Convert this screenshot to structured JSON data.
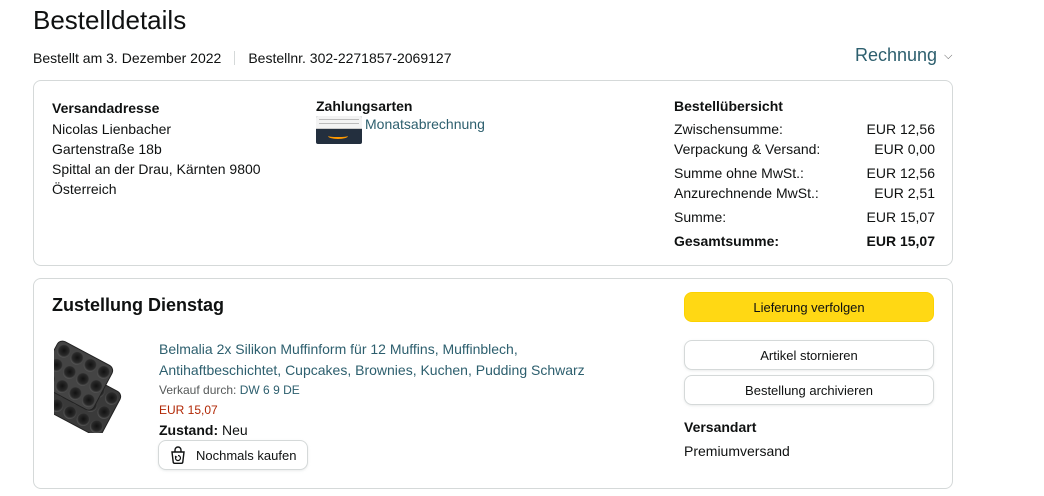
{
  "page": {
    "title": "Bestelldetails"
  },
  "meta": {
    "ordered_on": "Bestellt am 3. Dezember 2022",
    "order_number": "Bestellnr. 302-2271857-2069127"
  },
  "invoice": {
    "label": "Rechnung"
  },
  "address": {
    "heading": "Versandadresse",
    "lines": [
      "Nicolas Lienbacher",
      "Gartenstraße 18b",
      "Spittal an der Drau, Kärnten 9800",
      "Österreich"
    ]
  },
  "payment": {
    "heading": "Zahlungsarten",
    "method": "Monatsabrechnung",
    "icon": "credit-card-icon"
  },
  "summary": {
    "heading": "Bestellübersicht",
    "rows": [
      {
        "label": "Zwischensumme:",
        "value": "EUR 12,56"
      },
      {
        "label": "Verpackung & Versand:",
        "value": "EUR 0,00"
      },
      {
        "label": "Summe ohne MwSt.:",
        "value": "EUR 12,56"
      },
      {
        "label": "Anzurechnende MwSt.:",
        "value": "EUR 2,51"
      },
      {
        "label": "Summe:",
        "value": "EUR 15,07"
      }
    ],
    "grand_total": {
      "label": "Gesamtsumme:",
      "value": "EUR 15,07"
    }
  },
  "shipment": {
    "title": "Zustellung Dienstag",
    "product": {
      "title": "Belmalia 2x Silikon Muffinform für 12 Muffins, Muffinblech, Antihaftbeschichtet, Cupcakes, Brownies, Kuchen, Pudding Schwarz",
      "seller_prefix": "Verkauf durch:",
      "seller_name": "DW 6 9 DE",
      "price": "EUR 15,07",
      "condition_label": "Zustand:",
      "condition_value": "Neu",
      "buy_again_label": "Nochmals kaufen",
      "image_icon": "muffin-tray-image"
    },
    "actions": {
      "track": "Lieferung verfolgen",
      "cancel": "Artikel stornieren",
      "archive": "Bestellung archivieren"
    },
    "method": {
      "heading": "Versandart",
      "value": "Premiumversand"
    }
  },
  "colors": {
    "link": "#2d5f6e",
    "primary_button": "#ffd814",
    "price": "#b12704",
    "border": "#d5d9d9"
  }
}
